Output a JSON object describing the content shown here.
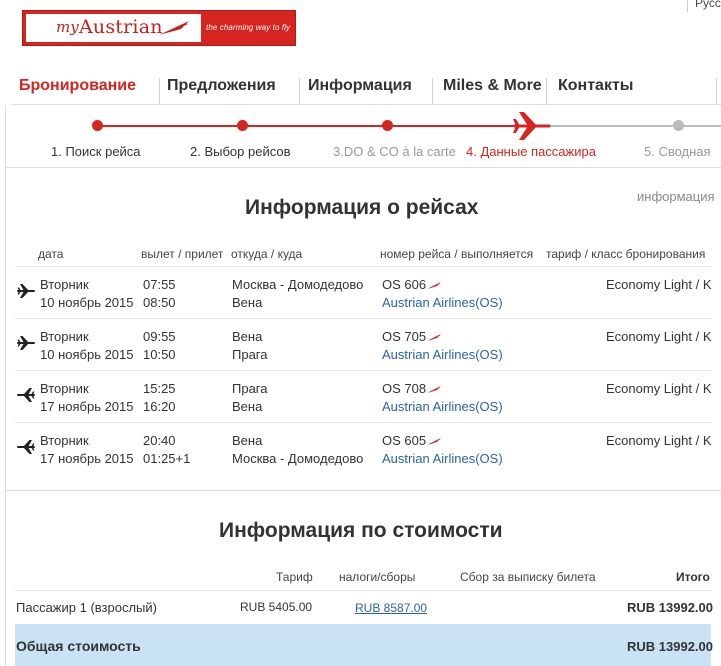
{
  "header": {
    "logo_my": "my",
    "logo_brand": "Austrian",
    "logo_slogan": "the charming way to fly",
    "language": "Русс"
  },
  "nav": {
    "items": [
      {
        "label": "Бронирование",
        "active": true
      },
      {
        "label": "Предложения"
      },
      {
        "label": "Информация"
      },
      {
        "label": "Miles & More"
      },
      {
        "label": "Контакты"
      }
    ]
  },
  "progress": {
    "steps": [
      {
        "label": "1. Поиск рейса",
        "state": "done"
      },
      {
        "label": "2. Выбор рейсов",
        "state": "done"
      },
      {
        "label": "3.DO & CO à la carte",
        "state": "done-muted"
      },
      {
        "label": "4. Данные пассажира",
        "state": "current"
      },
      {
        "label": "5. Сводная",
        "state": "upcoming"
      }
    ]
  },
  "side_info": "информация",
  "flights": {
    "title": "Информация о рейсах",
    "headers": {
      "date": "дата",
      "depart_arrive": "вылет / прилет",
      "from_to": "откуда / куда",
      "flight_no": "номер рейса / выполняется",
      "fare_class": "тариф / класс бронирования"
    },
    "rows": [
      {
        "day": "Вторник",
        "date": "10 ноябрь 2015",
        "dep": "07:55",
        "arr": "08:50",
        "from": "Москва - Домодедово",
        "to": "Вена",
        "flight": "OS 606",
        "carrier": "Austrian Airlines(OS)",
        "fare": "Economy Light / K",
        "direction": "outbound"
      },
      {
        "day": "Вторник",
        "date": "10 ноябрь 2015",
        "dep": "09:55",
        "arr": "10:50",
        "from": "Вена",
        "to": "Прага",
        "flight": "OS 705",
        "carrier": "Austrian Airlines(OS)",
        "fare": "Economy Light / K",
        "direction": "outbound"
      },
      {
        "day": "Вторник",
        "date": "17 ноябрь 2015",
        "dep": "15:25",
        "arr": "16:20",
        "from": "Прага",
        "to": "Вена",
        "flight": "OS 708",
        "carrier": "Austrian Airlines(OS)",
        "fare": "Economy Light / K",
        "direction": "return"
      },
      {
        "day": "Вторник",
        "date": "17 ноябрь 2015",
        "dep": "20:40",
        "arr": "01:25+1",
        "from": "Вена",
        "to": "Москва - Домодедово",
        "flight": "OS 605",
        "carrier": "Austrian Airlines(OS)",
        "fare": "Economy Light / K",
        "direction": "return"
      }
    ]
  },
  "pricing": {
    "title": "Информация по стоимости",
    "headers": {
      "fare": "Тариф",
      "taxes": "налоги/сборы",
      "ticketing_fee": "Сбор за выписку билета",
      "total": "Итого"
    },
    "passenger": {
      "label": "Пассажир 1 (взрослый)",
      "fare": "RUB 5405.00",
      "taxes": "RUB 8587.00",
      "total": "RUB 13992.00"
    },
    "grand_total": {
      "label": "Общая стоимость",
      "value": "RUB 13992.00"
    }
  },
  "colors": {
    "brand_red": "#d6241f",
    "link_blue": "#2a63a8",
    "total_bar": "#c9e3f4"
  }
}
